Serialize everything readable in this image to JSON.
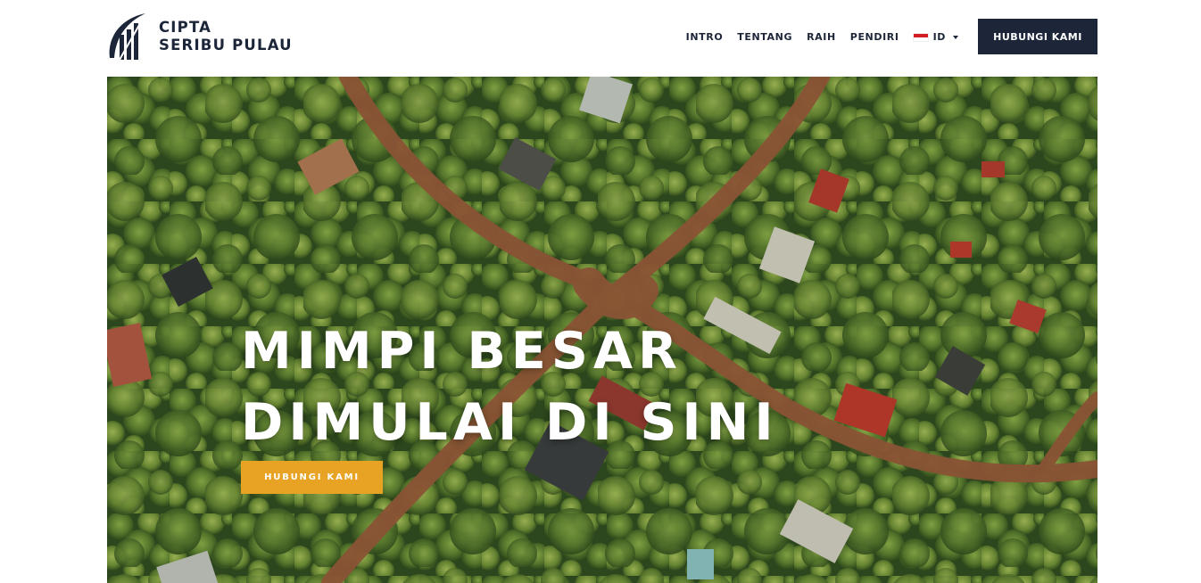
{
  "brand": {
    "line1": "CIPTA",
    "line2": "SERIBU PULAU",
    "logo_icon": "building-swoosh-logo",
    "color": "#1c2638"
  },
  "nav": {
    "items": [
      {
        "label": "INTRO"
      },
      {
        "label": "TENTANG"
      },
      {
        "label": "RAIH"
      },
      {
        "label": "PENDIRI"
      }
    ],
    "language": {
      "selected": "ID",
      "icon": "indonesia-flag-icon"
    }
  },
  "header_cta": {
    "label": "HUBUNGI KAMI",
    "color": "#1d2539"
  },
  "hero": {
    "title_line1": "MIMPI BESAR",
    "title_line2": "DIMULAI DI SINI",
    "cta_label": "HUBUNGI KAMI",
    "cta_color": "#e8a325",
    "background": "aerial-forest-photo"
  }
}
